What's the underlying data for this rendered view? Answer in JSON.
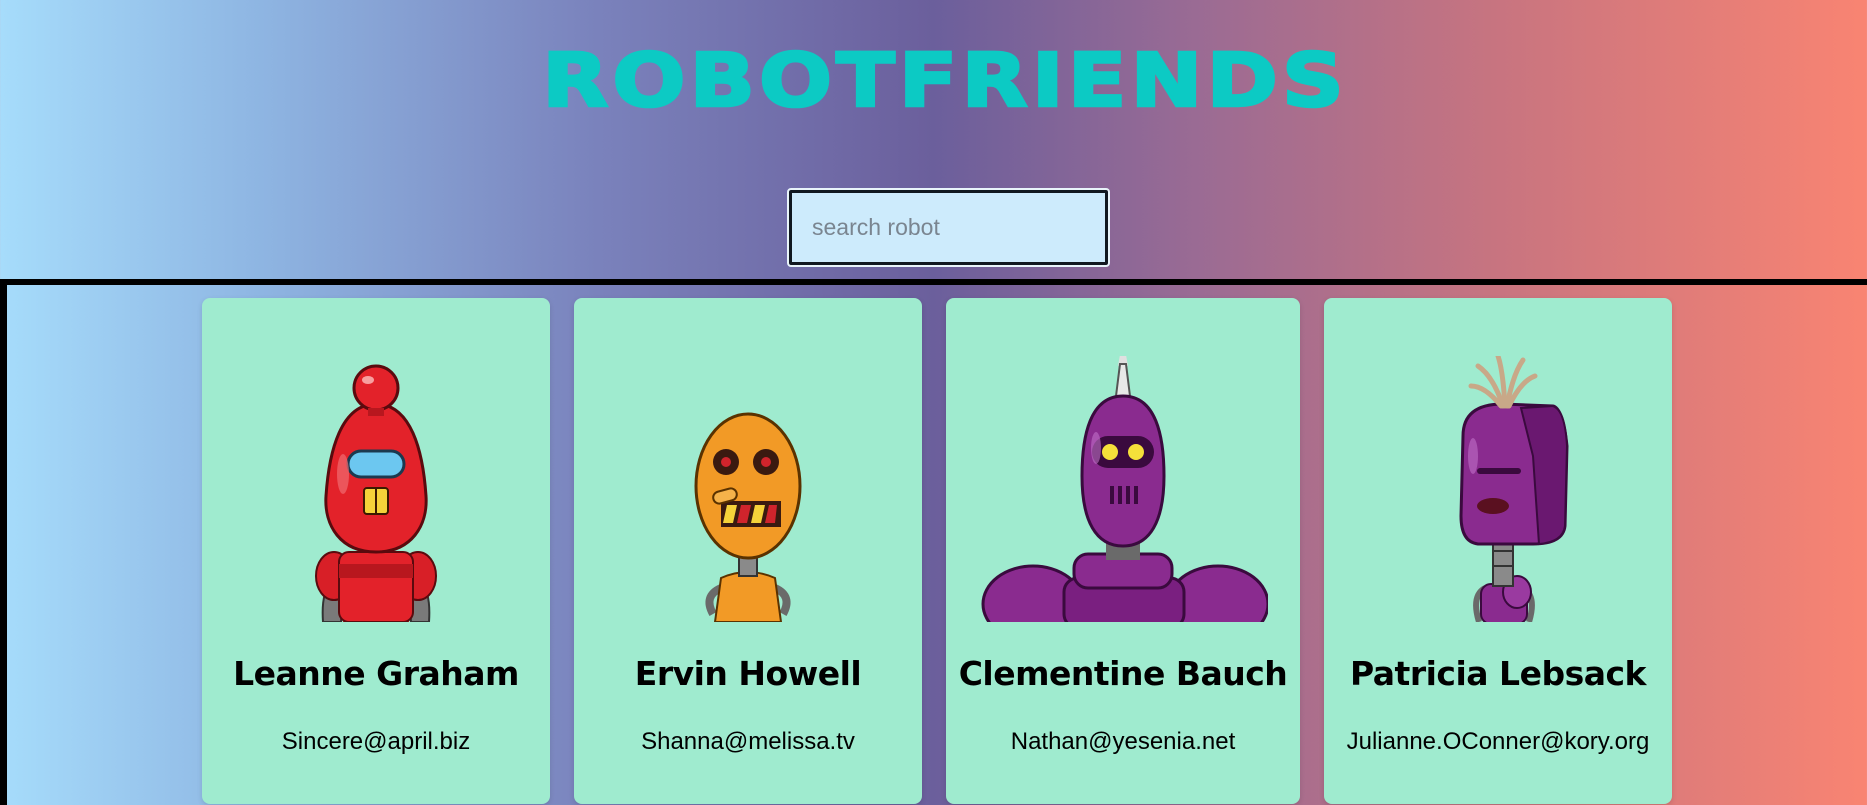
{
  "header": {
    "title": "ROBOTFRIENDS",
    "title_color": "#0ccac4"
  },
  "search": {
    "placeholder": "search robot",
    "value": ""
  },
  "colors": {
    "card_background": "#9febcf",
    "gradient_start": "#a6dcfb",
    "gradient_end": "#f98472"
  },
  "robots": [
    {
      "name": "Leanne Graham",
      "email": "Sincere@april.biz",
      "robot_color": "#e3222a"
    },
    {
      "name": "Ervin Howell",
      "email": "Shanna@melissa.tv",
      "robot_color": "#f29a26"
    },
    {
      "name": "Clementine Bauch",
      "email": "Nathan@yesenia.net",
      "robot_color": "#8a2b8f"
    },
    {
      "name": "Patricia Lebsack",
      "email": "Julianne.OConner@kory.org",
      "robot_color": "#8a2b8f"
    }
  ]
}
